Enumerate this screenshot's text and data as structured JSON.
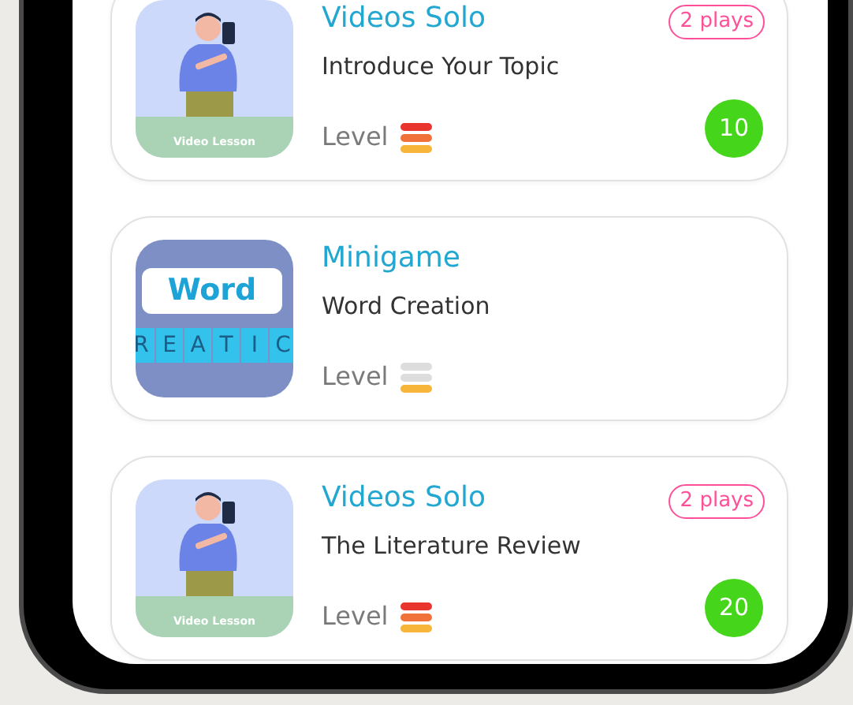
{
  "lessons": [
    {
      "kind": "video",
      "category": "Videos Solo",
      "title": "Introduce Your Topic",
      "level_label": "Level",
      "level": 1,
      "plays": "2 plays",
      "score": "10",
      "thumbnail": {
        "caption": "Video Lesson"
      }
    },
    {
      "kind": "word_game",
      "category": "Minigame",
      "title": "Word Creation",
      "level_label": "Level",
      "level": 0.33,
      "thumbnail": {
        "word": "Word",
        "tiles": [
          "R",
          "E",
          "A",
          "T",
          "I",
          "C"
        ]
      }
    },
    {
      "kind": "video",
      "category": "Videos Solo",
      "title": "The Literature Review",
      "level_label": "Level",
      "level": 1,
      "plays": "2 plays",
      "score": "20",
      "thumbnail": {
        "caption": "Video Lesson"
      }
    }
  ]
}
